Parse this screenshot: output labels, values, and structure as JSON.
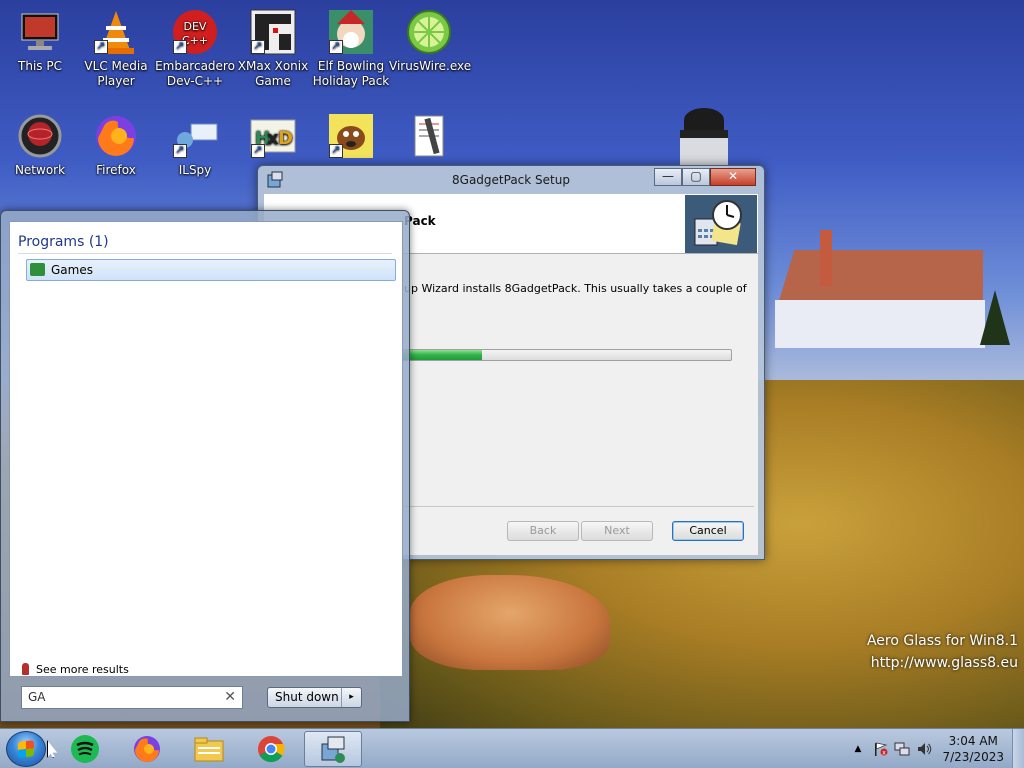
{
  "desktop": {
    "icons": [
      {
        "label": "This PC",
        "icon": "computer-icon"
      },
      {
        "label": "VLC Media Player",
        "icon": "vlc-cone-icon"
      },
      {
        "label": "Embarcadero Dev-C++",
        "icon": "devcpp-icon"
      },
      {
        "label": "XMax Xonix Game",
        "icon": "xonix-icon"
      },
      {
        "label": "Elf Bowling Holiday Pack",
        "icon": "elf-bowling-icon"
      },
      {
        "label": "VirusWire.exe",
        "icon": "lime-icon"
      },
      {
        "label": "Network",
        "icon": "network-globe-icon"
      },
      {
        "label": "Firefox",
        "icon": "firefox-icon"
      },
      {
        "label": "ILSpy",
        "icon": "ilspy-icon"
      },
      {
        "label": "",
        "icon": "hxd-icon"
      },
      {
        "label": "",
        "icon": "dog-game-icon"
      },
      {
        "label": "",
        "icon": "document-tool-icon"
      }
    ],
    "watermark_line1": "Aero Glass for Win8.1",
    "watermark_line2": "http://www.glass8.eu"
  },
  "setup_window": {
    "title": "8GadgetPack Setup",
    "banner_title": "Pack",
    "description": "up Wizard installs 8GadgetPack. This usually takes a couple of",
    "progress_percent": 45,
    "buttons": {
      "back": "Back",
      "next": "Next",
      "cancel": "Cancel"
    },
    "window_controls": {
      "minimize": "—",
      "maximize": "▢",
      "close": "✕"
    }
  },
  "start_menu": {
    "group_header": "Programs (1)",
    "results": [
      {
        "label": "Games",
        "icon": "games-icon"
      }
    ],
    "see_more": "See more results",
    "search_value": "GA",
    "search_clear": "✕",
    "shutdown_label": "Shut down",
    "shutdown_arrow": "▸"
  },
  "taskbar": {
    "pinned": [
      {
        "icon": "spotify-icon"
      },
      {
        "icon": "firefox-icon"
      },
      {
        "icon": "file-explorer-icon"
      },
      {
        "icon": "chrome-icon"
      },
      {
        "icon": "setup-installer-icon"
      }
    ],
    "tray": {
      "chevron": "▲",
      "time": "3:04 AM",
      "date": "7/23/2023"
    }
  },
  "colors": {
    "progress_fill": "#2eb34a",
    "start_menu_header": "#1e3a8a",
    "selection": "#cfe3f8"
  }
}
